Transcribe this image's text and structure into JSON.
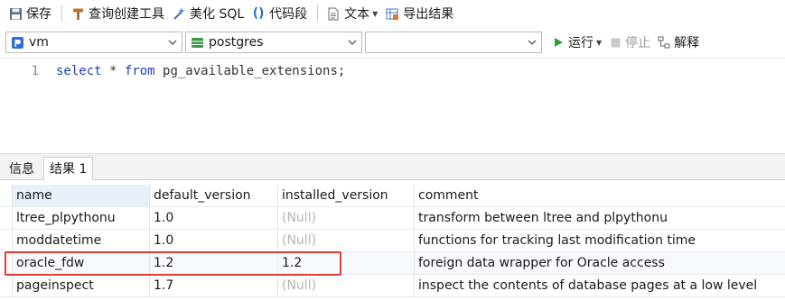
{
  "toolbar": {
    "save_label": "保存",
    "query_builder_label": "查询创建工具",
    "beautify_label": "美化 SQL",
    "snippet_label": "代码段",
    "text_label": "文本",
    "export_label": "导出结果"
  },
  "connection": {
    "server_value": "vm",
    "database_value": "postgres",
    "schema_value": ""
  },
  "run_controls": {
    "run_label": "运行",
    "stop_label": "停止",
    "explain_label": "解释"
  },
  "editor": {
    "line_number": "1",
    "code_keyword_select": "select",
    "code_mid": " * ",
    "code_keyword_from": "from",
    "code_rest": " pg_available_extensions;"
  },
  "tabs": [
    {
      "label": "信息"
    },
    {
      "label": "结果 1"
    }
  ],
  "results": {
    "columns": [
      "name",
      "default_version",
      "installed_version",
      "comment"
    ],
    "rows": [
      {
        "name": "ltree_plpythonu",
        "default_version": "1.0",
        "installed_version": "(Null)",
        "comment": "transform between ltree and plpythonu"
      },
      {
        "name": "moddatetime",
        "default_version": "1.0",
        "installed_version": "(Null)",
        "comment": "functions for tracking last modification time"
      },
      {
        "name": "oracle_fdw",
        "default_version": "1.2",
        "installed_version": "1.2",
        "comment": "foreign data wrapper for Oracle access"
      },
      {
        "name": "pageinspect",
        "default_version": "1.7",
        "installed_version": "(Null)",
        "comment": "inspect the contents of database pages at a low level"
      }
    ]
  },
  "colors": {
    "highlight_border": "#e23b3b",
    "keyword": "#1f3fbf",
    "null_text": "#b5b5b5",
    "run_green": "#2e9e3a"
  }
}
